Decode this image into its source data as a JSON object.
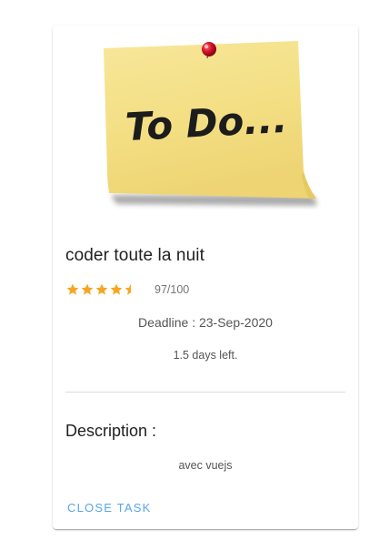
{
  "card": {
    "image_text": "To Do...",
    "title": "coder toute la nuit",
    "rating": {
      "value": 4.5,
      "max": 5,
      "score_label": "97/100",
      "star_color": "#f5a623"
    },
    "deadline": "Deadline : 23-Sep-2020",
    "days_left": "1.5 days left.",
    "description_heading": "Description :",
    "description_text": "avec vuejs",
    "close_button_label": "CLOSE TASK",
    "accent_color": "#5aa6ea"
  }
}
